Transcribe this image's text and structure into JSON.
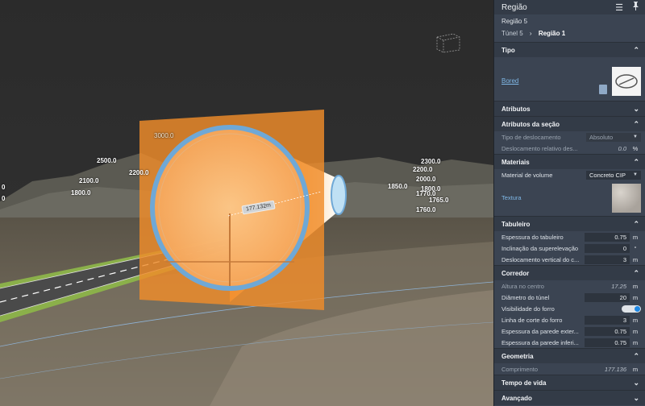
{
  "viewport": {
    "elevation_labels": [
      {
        "text": "3000.0",
        "style": "dim"
      },
      {
        "text": "2500.0",
        "style": "bold"
      },
      {
        "text": "2200.0",
        "style": "bold"
      },
      {
        "text": "2100.0",
        "style": "bold"
      },
      {
        "text": "1800.0",
        "style": "bold"
      },
      {
        "text": "0",
        "style": "bold"
      },
      {
        "text": "0",
        "style": "bold"
      },
      {
        "text": "2300.0",
        "style": "bold"
      },
      {
        "text": "2200.0",
        "style": "bold"
      },
      {
        "text": "2000.0",
        "style": "bold"
      },
      {
        "text": "1850.0",
        "style": "bold"
      },
      {
        "text": "1800.0",
        "style": "bold"
      },
      {
        "text": "1770.0",
        "style": "bold"
      },
      {
        "text": "1765.0",
        "style": "bold"
      },
      {
        "text": "1760.0",
        "style": "bold"
      }
    ],
    "measurement": "177.132m",
    "colors": {
      "section_plane": "#f08c2a",
      "tunnel_ring": "#6fa8d6",
      "road": "#4a4a4a",
      "grass": "#8bb04a"
    }
  },
  "panel": {
    "title": "Região",
    "subtitle": "Região 5",
    "breadcrumb": {
      "parent": "Túnel 5",
      "current": "Região 1"
    },
    "sections": {
      "tipo": {
        "label": "Tipo",
        "link": "Bored"
      },
      "atributos": {
        "label": "Atributos"
      },
      "atributos_secao": {
        "label": "Atributos da seção",
        "rows": {
          "tipo_deslocamento": {
            "label": "Tipo de deslocamento",
            "value": "Absoluto"
          },
          "deslocamento_relativo": {
            "label": "Deslocamento relativo des...",
            "value": "0.0",
            "unit": "%"
          }
        }
      },
      "materiais": {
        "label": "Materiais",
        "material_volume": {
          "label": "Material de volume",
          "value": "Concreto CIP"
        },
        "textura": "Textura"
      },
      "tabuleiro": {
        "label": "Tabuleiro",
        "rows": [
          {
            "label": "Espessura do tabuleiro",
            "value": "0.75",
            "unit": "m"
          },
          {
            "label": "Inclinação da superelevação",
            "value": "0",
            "unit": "°"
          },
          {
            "label": "Deslocamento vertical do c...",
            "value": "3",
            "unit": "m"
          }
        ]
      },
      "corredor": {
        "label": "Corredor",
        "altura": {
          "label": "Altura no centro",
          "value": "17.25",
          "unit": "m"
        },
        "diametro": {
          "label": "Diâmetro do túnel",
          "value": "20",
          "unit": "m"
        },
        "visibilidade": {
          "label": "Visibilidade do forro",
          "state": "on"
        },
        "rows": [
          {
            "label": "Linha de corte do forro",
            "value": "3",
            "unit": "m"
          },
          {
            "label": "Espessura da parede exter...",
            "value": "0.75",
            "unit": "m"
          },
          {
            "label": "Espessura da parede inferi...",
            "value": "0.75",
            "unit": "m"
          }
        ]
      },
      "geometria": {
        "label": "Geometria",
        "comprimento": {
          "label": "Comprimento",
          "value": "177.136",
          "unit": "m"
        }
      },
      "tempo_vida": {
        "label": "Tempo de vida"
      },
      "avancado": {
        "label": "Avançado"
      }
    }
  }
}
